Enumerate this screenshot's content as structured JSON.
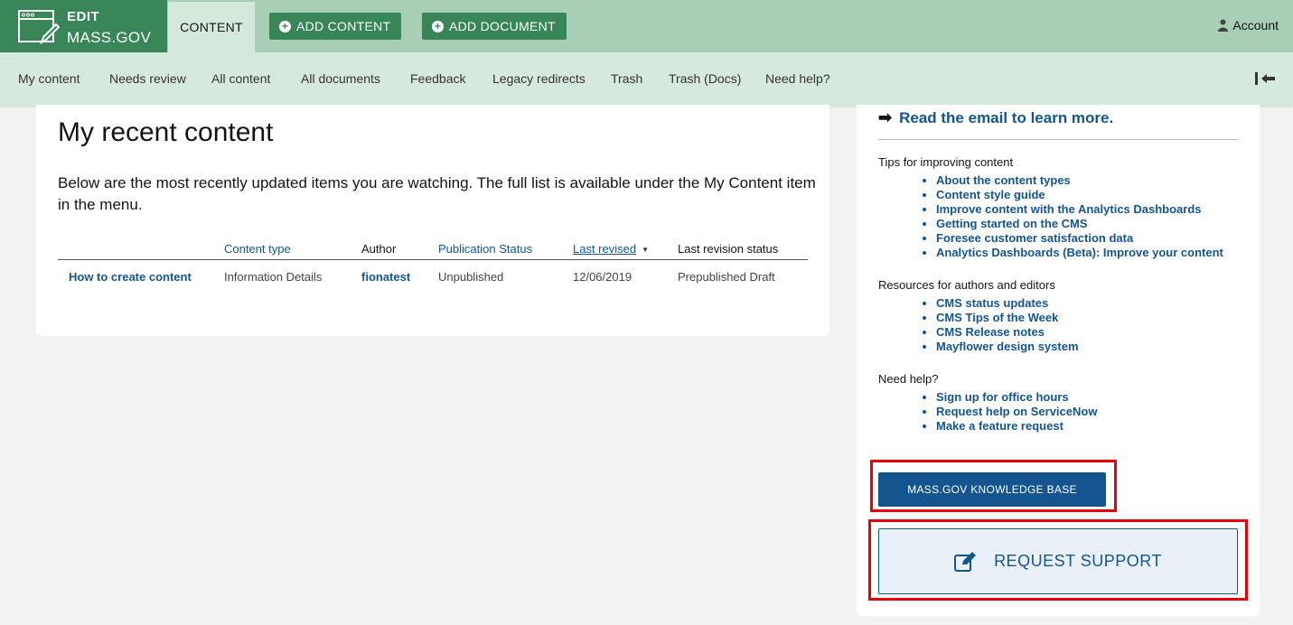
{
  "brand": {
    "line1": "EDIT",
    "line2": "MASS.GOV",
    "icon": "browser-pencil-icon"
  },
  "topnav": {
    "content_tab": "CONTENT",
    "add_content": "ADD CONTENT",
    "add_document": "ADD DOCUMENT",
    "account": "Account"
  },
  "subnav": {
    "items": [
      "My content",
      "Needs review",
      "All content",
      "All documents",
      "Feedback",
      "Legacy redirects",
      "Trash",
      "Trash (Docs)",
      "Need help?"
    ]
  },
  "main": {
    "title": "My recent content",
    "intro": "Below are the most recently updated items you are watching. The full list is available under the My Content item in the menu.",
    "table": {
      "headers": [
        "",
        "Content type",
        "Author",
        "Publication Status",
        "Last revised",
        "Last revision status"
      ],
      "rows": [
        [
          "How to create content",
          "Information Details",
          "fionatest",
          "Unpublished",
          "12/06/2019",
          "Prepublished Draft"
        ]
      ]
    }
  },
  "sidebar": {
    "read_email": "Read the email to learn more.",
    "tips_title": "Tips for improving content",
    "tips": [
      "About the content types",
      "Content style guide",
      "Improve content with the Analytics Dashboards",
      "Getting started on the CMS",
      "Foresee customer satisfaction data",
      "Analytics Dashboards (Beta): Improve your content"
    ],
    "resources_title": "Resources for authors and editors",
    "resources": [
      "CMS status updates",
      "CMS Tips of the Week",
      "CMS Release notes",
      "Mayflower design system"
    ],
    "help_title": "Need help?",
    "help": [
      "Sign up for office hours",
      "Request help on ServiceNow",
      "Make a feature request"
    ],
    "knowledge_base": "MASS.GOV KNOWLEDGE BASE",
    "request_support": "REQUEST SUPPORT"
  },
  "colors": {
    "brand_green": "#388557",
    "link_blue": "#14558f",
    "highlight_red": "#e8000b"
  }
}
